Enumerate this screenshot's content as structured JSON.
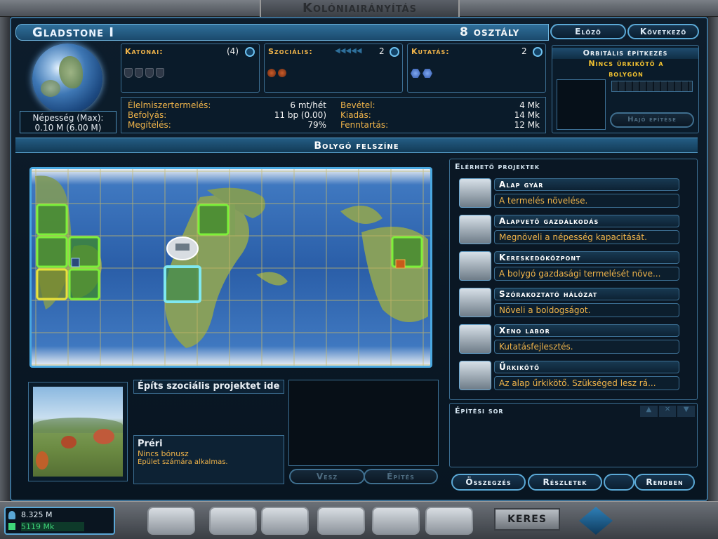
{
  "window": {
    "title": "Kolóniairányítás"
  },
  "planet": {
    "name": "Gladstone I",
    "class": "8 osztály",
    "population_label": "Népesség (Max):",
    "population_value": "0.10 M (6.00 M)"
  },
  "nav": {
    "prev": "Előző",
    "next": "Következő"
  },
  "stats": {
    "military": {
      "label": "Katonai:",
      "value": "(4)"
    },
    "social": {
      "label": "Szociális:",
      "value": "2"
    },
    "research": {
      "label": "Kutatás:",
      "value": "2"
    }
  },
  "economy": {
    "food_label": "Élelmiszertermelés:",
    "food_value": "6 mt/hét",
    "influence_label": "Befolyás:",
    "influence_value": "11 bp (0.00)",
    "approval_label": "Megítélés:",
    "approval_value": "79%",
    "income_label": "Bevétel:",
    "income_value": "4 Mk",
    "expense_label": "Kiadás:",
    "expense_value": "14 Mk",
    "upkeep_label": "Fenntartás:",
    "upkeep_value": "12 Mk"
  },
  "orbital": {
    "title": "Orbitális építkezés",
    "message": "Nincs űrkikötő a bolygón",
    "build_ship": "Hajó építése"
  },
  "surface": {
    "title": "Bolygó felszíne",
    "build_here": "Építs szociális projektet ide",
    "terrain_name": "Préri",
    "terrain_bonus": "Nincs bónusz",
    "terrain_note": "Épület számára alkalmas.",
    "buy": "Vesz",
    "build": "Építés"
  },
  "projects": {
    "title": "Elérhető projektek",
    "items": [
      {
        "name": "Alap gyár",
        "desc": "A termelés növelése.",
        "icon": "factory-icon"
      },
      {
        "name": "Alapvető gazdálkodás",
        "desc": "Megnöveli a népesség kapacitását.",
        "icon": "farming-icon"
      },
      {
        "name": "Kereskedőközpont",
        "desc": "A bolygó gazdasági termelését növe...",
        "icon": "trade-center-icon"
      },
      {
        "name": "Szórakoztató hálózat",
        "desc": "Növeli a boldogságot.",
        "icon": "entertainment-icon"
      },
      {
        "name": "Xeno labor",
        "desc": "Kutatásfejlesztés.",
        "icon": "xeno-lab-icon"
      },
      {
        "name": "Űrkikötő",
        "desc": "Az alap űrkikötő. Szükséged lesz rá...",
        "icon": "starport-icon"
      }
    ]
  },
  "queue": {
    "title": "Építési sor"
  },
  "footer": {
    "summary": "Összegzés",
    "details": "Részletek",
    "ok": "Rendben"
  },
  "resources": {
    "population": "8.325 M",
    "credits": "5119 Mk"
  },
  "bottom": {
    "search": "KERES"
  },
  "colors": {
    "accent": "#5ba9d6",
    "gold": "#f0b44a",
    "green_tile": "#7cf03a",
    "yellow_tile": "#e8e23a",
    "selected_tile": "#7fe8f0"
  }
}
